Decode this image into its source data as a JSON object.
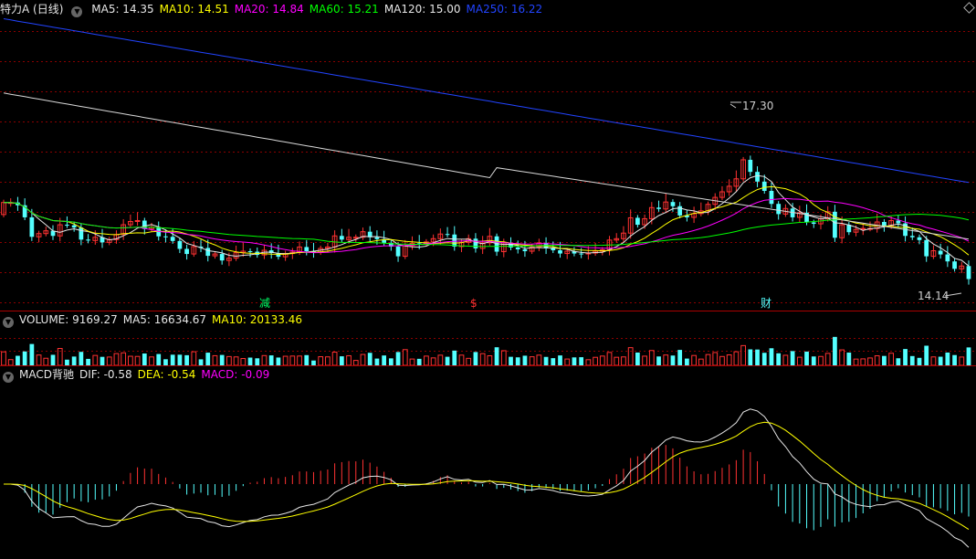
{
  "stock": {
    "name": "特力A",
    "period": "(日线)"
  },
  "ma_legend": [
    {
      "label": "MA5: 14.35",
      "color": "#e6e6e6"
    },
    {
      "label": "MA10: 14.51",
      "color": "#ffff00"
    },
    {
      "label": "MA20: 14.84",
      "color": "#ff00ff"
    },
    {
      "label": "MA60: 15.21",
      "color": "#00ff00"
    },
    {
      "label": "MA120: 15.00",
      "color": "#e6e6e6"
    },
    {
      "label": "MA250: 16.22",
      "color": "#2244ff"
    }
  ],
  "volume_legend": [
    {
      "label": "VOLUME: 9169.27",
      "color": "#e6e6e6"
    },
    {
      "label": "MA5: 16634.67",
      "color": "#e6e6e6"
    },
    {
      "label": "MA10: 20133.46",
      "color": "#ffff00"
    }
  ],
  "macd_legend": [
    {
      "label": "MACD背驰",
      "color": "#e6e6e6"
    },
    {
      "label": "DIF: -0.58",
      "color": "#e6e6e6"
    },
    {
      "label": "DEA: -0.54",
      "color": "#ffff00"
    },
    {
      "label": "MACD: -0.09",
      "color": "#ff00ff"
    }
  ],
  "annotations": {
    "high": "17.30",
    "low": "14.14",
    "event_1": "减",
    "event_2": "$",
    "event_3": "财"
  },
  "colors": {
    "up": "#ff3232",
    "down": "#54ffff",
    "grid": "#8b0000",
    "divider": "#aa0000"
  },
  "chart_data": {
    "type": "candlestick",
    "y_range": [
      13.5,
      19.8
    ],
    "high": 17.3,
    "low": 14.14,
    "last_close": 14.14,
    "ma_last": {
      "MA5": 14.35,
      "MA10": 14.51,
      "MA20": 14.84,
      "MA60": 15.21,
      "MA120": 15.0,
      "MA250": 16.22
    },
    "volume": {
      "last": 9169.27,
      "ma5": 16634.67,
      "ma10": 20133.46
    },
    "macd": {
      "dif": -0.58,
      "dea": -0.54,
      "macd": -0.09
    },
    "closes": [
      15.79,
      15.79,
      15.73,
      15.47,
      15.05,
      15.12,
      15.18,
      15.07,
      15.31,
      15.3,
      15.25,
      14.99,
      14.97,
      15.04,
      14.93,
      14.99,
      15.1,
      15.31,
      15.38,
      15.4,
      15.22,
      15.26,
      15.06,
      15.05,
      14.96,
      14.79,
      14.68,
      14.84,
      14.81,
      14.64,
      14.68,
      14.54,
      14.59,
      14.71,
      14.74,
      14.73,
      14.66,
      14.76,
      14.7,
      14.62,
      14.69,
      14.72,
      14.83,
      14.74,
      14.72,
      14.8,
      14.83,
      15.07,
      14.99,
      15.04,
      15.04,
      15.16,
      15.04,
      15.0,
      14.92,
      14.84,
      14.63,
      14.86,
      14.91,
      14.9,
      14.94,
      15.01,
      15.11,
      15.1,
      14.84,
      14.93,
      15.01,
      14.8,
      14.92,
      15.06,
      14.73,
      14.92,
      14.82,
      14.78,
      14.74,
      14.83,
      14.92,
      14.8,
      14.76,
      14.69,
      14.74,
      14.69,
      14.68,
      14.7,
      14.74,
      14.77,
      14.98,
      15.01,
      15.13,
      15.46,
      15.31,
      15.44,
      15.68,
      15.65,
      15.8,
      15.71,
      15.51,
      15.47,
      15.55,
      15.61,
      15.75,
      15.9,
      16.02,
      16.14,
      16.3,
      16.71,
      16.45,
      16.24,
      16.04,
      15.76,
      15.54,
      15.66,
      15.47,
      15.57,
      15.36,
      15.33,
      15.44,
      15.59,
      15.03,
      15.31,
      15.15,
      15.21,
      15.23,
      15.23,
      15.37,
      15.28,
      15.4,
      15.34,
      15.07,
      15.04,
      14.98,
      14.63,
      14.75,
      14.67,
      14.52,
      14.36,
      14.42,
      14.14
    ],
    "opens": [
      15.53,
      15.79,
      15.79,
      15.73,
      15.47,
      15.05,
      15.12,
      15.18,
      15.07,
      15.31,
      15.3,
      15.25,
      14.99,
      14.97,
      15.04,
      14.93,
      14.99,
      15.1,
      15.31,
      15.38,
      15.4,
      15.22,
      15.26,
      15.06,
      15.05,
      14.96,
      14.79,
      14.68,
      14.84,
      14.81,
      14.64,
      14.68,
      14.54,
      14.59,
      14.71,
      14.74,
      14.73,
      14.66,
      14.76,
      14.7,
      14.62,
      14.69,
      14.72,
      14.83,
      14.74,
      14.72,
      14.8,
      14.83,
      15.07,
      14.99,
      15.04,
      15.04,
      15.16,
      15.04,
      15.0,
      14.92,
      14.84,
      14.63,
      14.86,
      14.91,
      14.9,
      14.94,
      15.01,
      15.11,
      15.1,
      14.84,
      14.93,
      15.01,
      14.8,
      14.92,
      15.06,
      14.73,
      14.92,
      14.82,
      14.78,
      14.74,
      14.83,
      14.92,
      14.8,
      14.76,
      14.69,
      14.74,
      14.69,
      14.68,
      14.7,
      14.74,
      14.77,
      14.98,
      15.01,
      15.13,
      15.46,
      15.31,
      15.44,
      15.68,
      15.65,
      15.8,
      15.71,
      15.51,
      15.47,
      15.55,
      15.61,
      15.75,
      15.9,
      16.02,
      16.14,
      16.3,
      16.71,
      16.45,
      16.24,
      16.04,
      15.76,
      15.54,
      15.66,
      15.47,
      15.57,
      15.36,
      15.33,
      15.44,
      15.59,
      15.03,
      15.31,
      15.15,
      15.21,
      15.23,
      15.23,
      15.37,
      15.28,
      15.4,
      15.34,
      15.07,
      15.04,
      14.98,
      14.63,
      14.75,
      14.67,
      14.52,
      14.36,
      14.42
    ]
  }
}
